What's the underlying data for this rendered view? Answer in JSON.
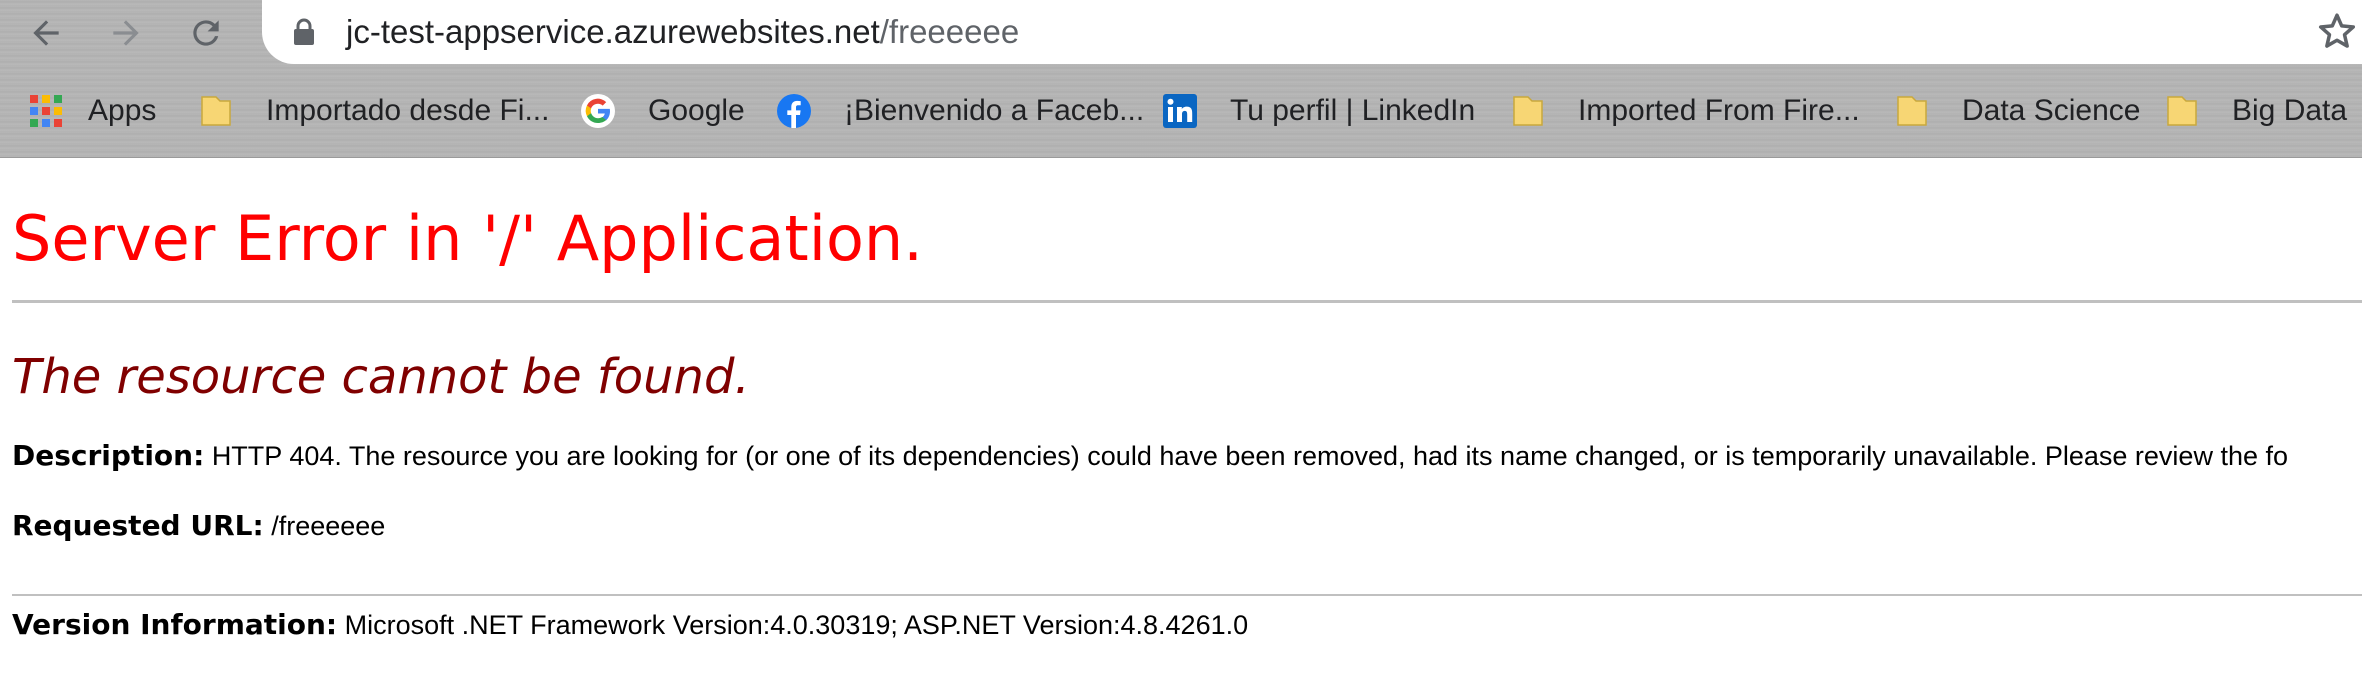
{
  "browser": {
    "address": {
      "host": "jc-test-appservice.azurewebsites.net",
      "path": "/freeeeee"
    },
    "icons": {
      "back": "arrow-left-icon",
      "forward": "arrow-right-icon",
      "reload": "reload-icon",
      "lock": "lock-icon",
      "star": "star-icon"
    },
    "bookmarks": [
      {
        "label": "Apps",
        "icon": "apps-grid-icon"
      },
      {
        "label": "Importado desde Fi...",
        "icon": "folder-icon"
      },
      {
        "label": "Google",
        "icon": "google-icon"
      },
      {
        "label": "¡Bienvenido a Faceb...",
        "icon": "facebook-icon"
      },
      {
        "label": "Tu perfil | LinkedIn",
        "icon": "linkedin-icon"
      },
      {
        "label": "Imported From Fire...",
        "icon": "folder-icon"
      },
      {
        "label": "Data Science",
        "icon": "folder-icon"
      },
      {
        "label": "Big Data",
        "icon": "folder-icon"
      }
    ]
  },
  "page": {
    "title": "Server Error in '/' Application.",
    "subtitle": "The resource cannot be found.",
    "description_label": "Description:",
    "description_text": "HTTP 404. The resource you are looking for (or one of its dependencies) could have been removed, had its name changed, or is temporarily unavailable.  Please review the fo",
    "requested_url_label": "Requested URL:",
    "requested_url_value": "/freeeeee",
    "version_label": "Version Information:",
    "version_value": "Microsoft .NET Framework Version:4.0.30319; ASP.NET Version:4.8.4261.0"
  },
  "colors": {
    "title": "#ff0000",
    "subtitle": "#800000",
    "facebook": "#1877f2",
    "linkedin": "#0a66c2",
    "folder": "#f7d674"
  }
}
